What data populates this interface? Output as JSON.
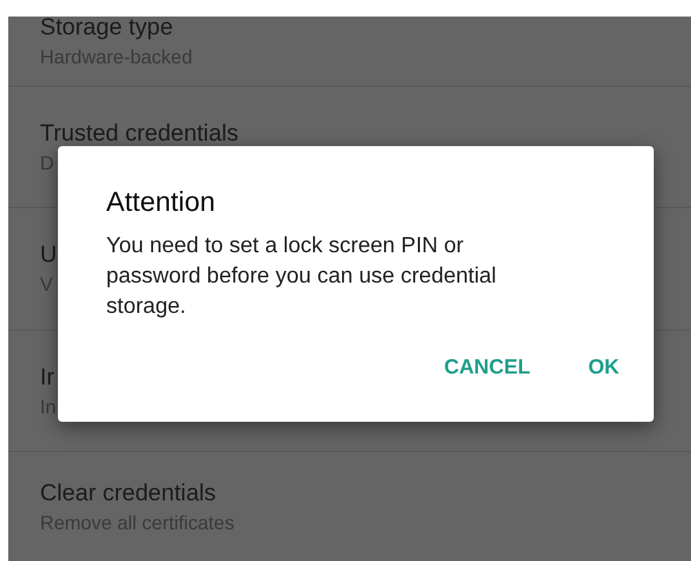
{
  "settings": [
    {
      "title": "Storage type",
      "subtitle": "Hardware-backed"
    },
    {
      "title": "Trusted credentials",
      "subtitle": "D"
    },
    {
      "title": "U",
      "subtitle": "V"
    },
    {
      "title": "Ir",
      "subtitle": "In"
    },
    {
      "title": "Clear credentials",
      "subtitle": "Remove all certificates"
    }
  ],
  "dialog": {
    "title": "Attention",
    "message": "You need to set a lock screen PIN or password before you can use credential storage.",
    "buttons": [
      "CANCEL",
      "OK"
    ]
  }
}
